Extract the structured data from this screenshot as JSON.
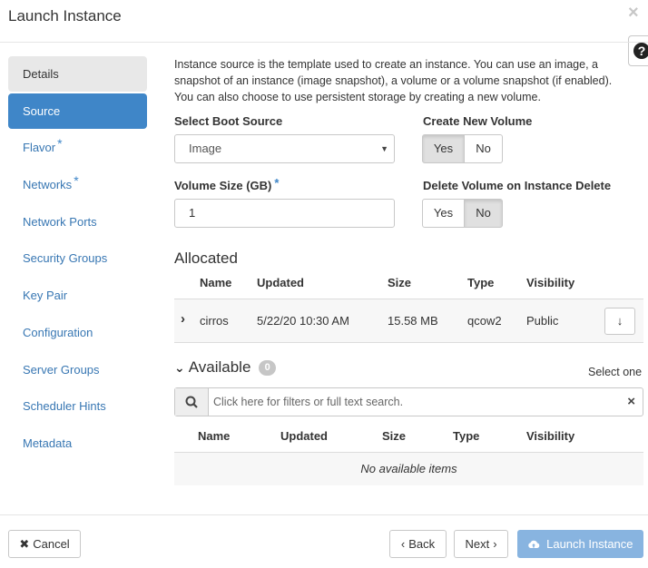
{
  "modal": {
    "title": "Launch Instance",
    "close_glyph": "×",
    "help_glyph": "?"
  },
  "sidebar": {
    "items": [
      {
        "label": "Details",
        "required": false,
        "state": "visited"
      },
      {
        "label": "Source",
        "required": false,
        "state": "active"
      },
      {
        "label": "Flavor",
        "required": true,
        "state": "normal"
      },
      {
        "label": "Networks",
        "required": true,
        "state": "normal"
      },
      {
        "label": "Network Ports",
        "required": false,
        "state": "normal"
      },
      {
        "label": "Security Groups",
        "required": false,
        "state": "normal"
      },
      {
        "label": "Key Pair",
        "required": false,
        "state": "normal"
      },
      {
        "label": "Configuration",
        "required": false,
        "state": "normal"
      },
      {
        "label": "Server Groups",
        "required": false,
        "state": "normal"
      },
      {
        "label": "Scheduler Hints",
        "required": false,
        "state": "normal"
      },
      {
        "label": "Metadata",
        "required": false,
        "state": "normal"
      }
    ],
    "required_marker": "*"
  },
  "source": {
    "intro": "Instance source is the template used to create an instance. You can use an image, a snapshot of an instance (image snapshot), a volume or a volume snapshot (if enabled). You can also choose to use persistent storage by creating a new volume.",
    "boot_source_label": "Select Boot Source",
    "boot_source_value": "Image",
    "create_volume_label": "Create New Volume",
    "create_volume_yes": "Yes",
    "create_volume_no": "No",
    "create_volume_selected": "Yes",
    "volume_size_label": "Volume Size (GB)",
    "volume_size_value": "1",
    "delete_volume_label": "Delete Volume on Instance Delete",
    "delete_volume_yes": "Yes",
    "delete_volume_no": "No",
    "delete_volume_selected": "No"
  },
  "allocated": {
    "title": "Allocated",
    "columns": [
      "Name",
      "Updated",
      "Size",
      "Type",
      "Visibility"
    ],
    "rows": [
      {
        "name": "cirros",
        "updated": "5/22/20 10:30 AM",
        "size": "15.58 MB",
        "type": "qcow2",
        "visibility": "Public"
      }
    ]
  },
  "available": {
    "title": "Available",
    "count": "0",
    "select_hint": "Select one",
    "search_placeholder": "Click here for filters or full text search.",
    "columns": [
      "Name",
      "Updated",
      "Size",
      "Type",
      "Visibility"
    ],
    "empty_text": "No available items"
  },
  "footer": {
    "cancel": "Cancel",
    "back": "Back",
    "next": "Next",
    "launch": "Launch Instance"
  },
  "colors": {
    "primary": "#3f86c8",
    "link": "#3877b3",
    "launch_disabled": "#88b4e0"
  }
}
